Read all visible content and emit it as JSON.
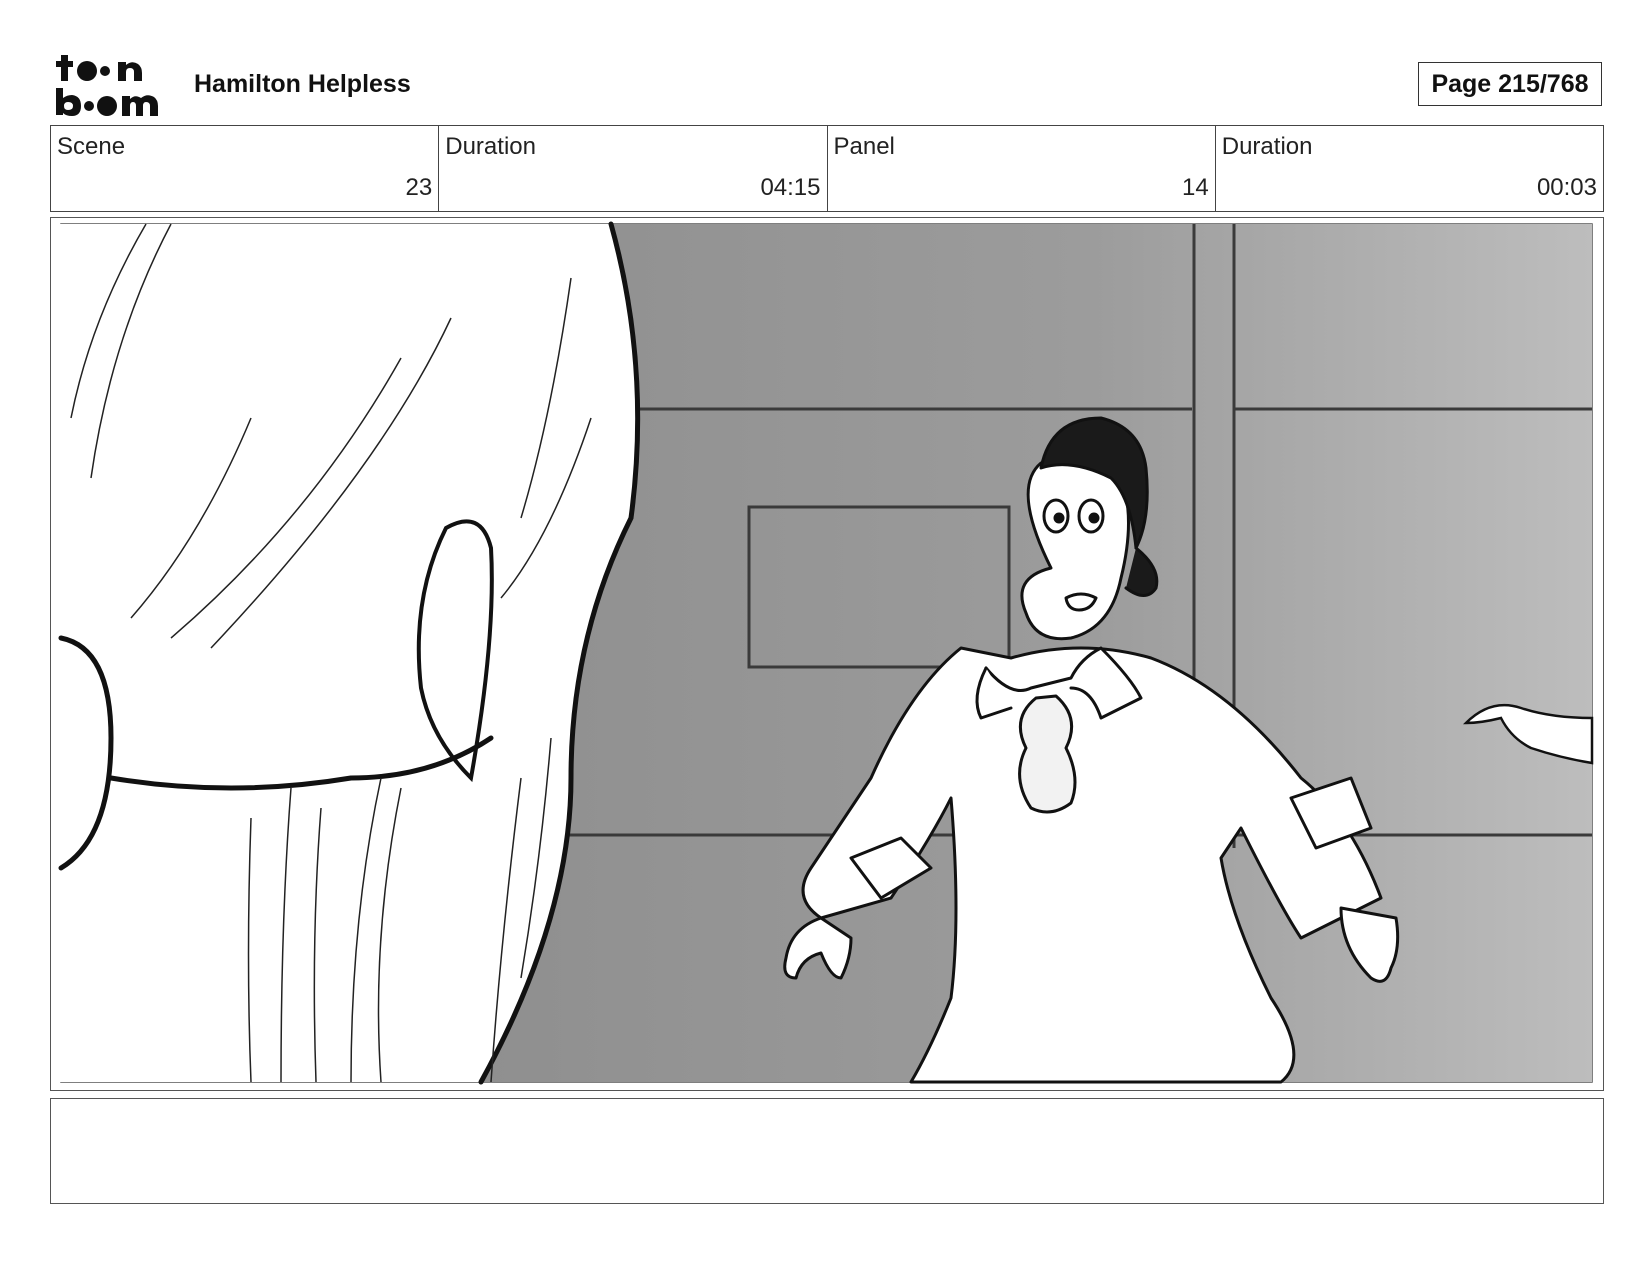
{
  "header": {
    "logo": {
      "icon": "toonboom-logo-icon",
      "line1": "toon",
      "line2": "boom"
    },
    "project_title": "Hamilton Helpless",
    "page_label": "Page 215/768"
  },
  "info": {
    "scene_label": "Scene",
    "scene_value": "23",
    "scene_duration_label": "Duration",
    "scene_duration_value": "04:15",
    "panel_label": "Panel",
    "panel_value": "14",
    "panel_duration_label": "Duration",
    "panel_duration_value": "00:03"
  },
  "panel": {
    "image_icon": "storyboard-sketch-image",
    "background_color": "#9a9a9a"
  },
  "notes": {
    "text": ""
  }
}
